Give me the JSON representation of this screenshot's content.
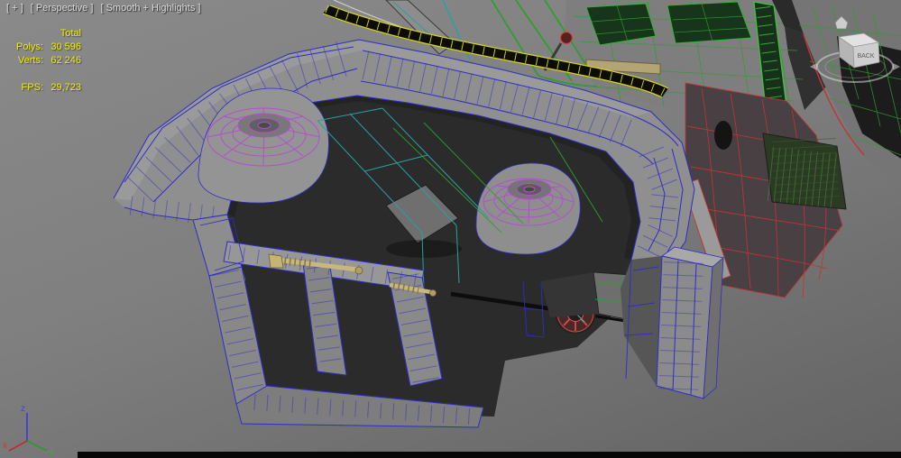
{
  "viewport_label": {
    "general": "[ + ]",
    "pov": "[ Perspective ]",
    "shading": "[ Smooth + Highlights ]"
  },
  "stats": {
    "total_label": "Total",
    "rows": [
      {
        "label": "Polys:",
        "value": "30 596"
      },
      {
        "label": "Verts:",
        "value": "62 246"
      }
    ],
    "fps": {
      "label": "FPS:",
      "value": "29,723"
    }
  },
  "axis": {
    "x": "x",
    "y": "y",
    "z": "z"
  },
  "viewcube": {
    "back": "BACK"
  },
  "colors": {
    "background_top": "#8a8a8a",
    "background_bottom": "#636363",
    "stats_text": "#f0ef00",
    "label_text": "#dcdcdc",
    "wire_blue": "#2d2dc8",
    "wire_purple": "#b44fd0",
    "wire_green": "#2f9e2f",
    "wire_teal": "#2aa0a0",
    "wire_red": "#c23535",
    "wire_yellow": "#d6d61e",
    "driveshaft_tan": "#c9b87c"
  }
}
